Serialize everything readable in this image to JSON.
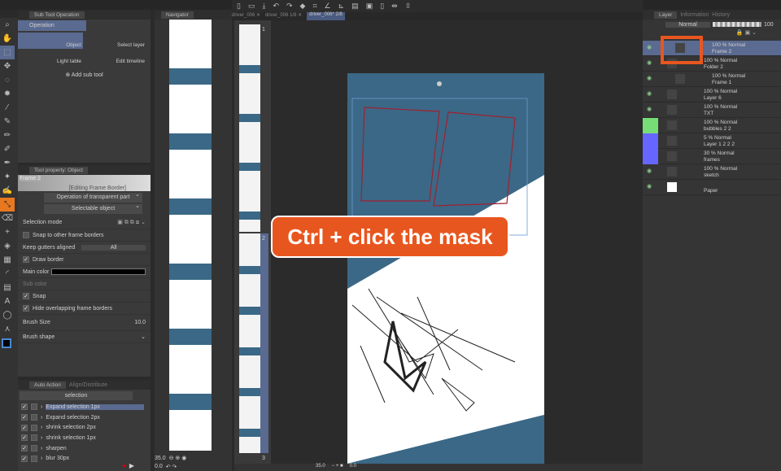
{
  "toolbar_tabs": {
    "navigator": "Navigator",
    "tabs": [
      {
        "label": "driver_006",
        "page": ""
      },
      {
        "label": "driver_006",
        "page": "1/8"
      },
      {
        "label": "driver_006*",
        "page": "2/8"
      }
    ]
  },
  "subtool": {
    "title": "Sub Tool Operation",
    "group": "Operation",
    "items": [
      "Object",
      "Select layer",
      "Light table",
      "Edit timeline"
    ],
    "add": "Add sub tool"
  },
  "toolprop": {
    "title": "Tool property: Object",
    "frame": "Frame 2",
    "editing": "[Editing Frame Border]",
    "transparent": "Operation of transparent part",
    "selectable": "Selectable object",
    "selection_mode": "Selection mode",
    "snap_frames": "Snap to other frame borders",
    "gutters": "Keep gutters aligned",
    "gutters_value": "All",
    "draw_border": "Draw border",
    "main_color": "Main color",
    "sub_color": "Sub color",
    "snap": "Snap",
    "hide_overlap": "Hide overlapping frame borders",
    "brush_size": "Brush Size",
    "brush_size_value": "10.0",
    "brush_shape": "Brush shape"
  },
  "autoaction": {
    "tab1": "Auto Action",
    "tab2": "Align/Distribute",
    "set": "selection",
    "items": [
      "Expand selection 1px",
      "Expand selection 2px",
      "shrink selection 2px",
      "shrink selection 1px",
      "sharpen",
      "blur 30px"
    ]
  },
  "nav": {
    "zoom": "35.0",
    "rotate": "0.0"
  },
  "pages": [
    "1",
    "2",
    "3"
  ],
  "status": {
    "zoom": "35.0",
    "angle": "0.0"
  },
  "banner": "Ctrl + click the mask",
  "layer": {
    "tabs": [
      "Layer",
      "Information",
      "History"
    ],
    "blend": "Normal",
    "opacity": "100",
    "rows": [
      {
        "mode": "100 % Normal",
        "name": "Frame 2"
      },
      {
        "mode": "100 % Normal",
        "name": "Folder 2"
      },
      {
        "mode": "100 % Normal",
        "name": "Frame 1"
      },
      {
        "mode": "100 % Normal",
        "name": "Layer 6"
      },
      {
        "mode": "100 % Normal",
        "name": "TXT"
      },
      {
        "mode": "100 % Normal",
        "name": "bubbles 2 2"
      },
      {
        "mode": "5 % Normal",
        "name": "Layer 1 2 2 2"
      },
      {
        "mode": "30 % Normal",
        "name": "frames"
      },
      {
        "mode": "100 % Normal",
        "name": "sketch"
      },
      {
        "mode": "",
        "name": "Paper"
      }
    ]
  },
  "colors": {
    "accent": "#e8561f",
    "page_blue": "#3b6886",
    "selected": "#5a6a90"
  }
}
